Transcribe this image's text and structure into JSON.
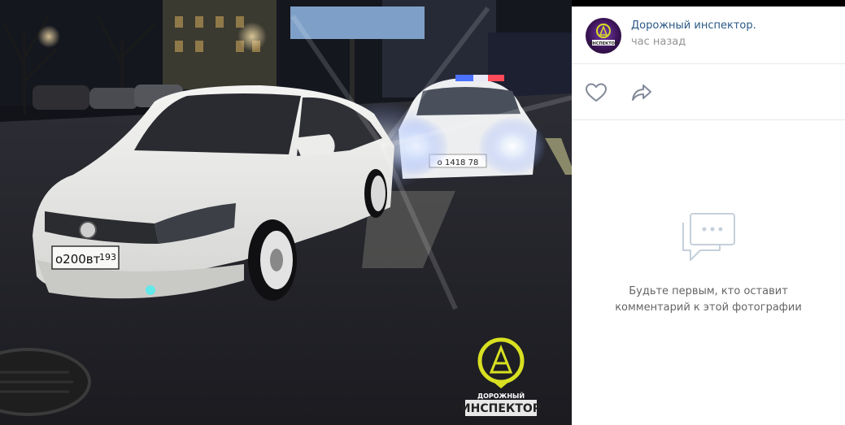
{
  "post": {
    "author": "Дорожный инспектор.",
    "time": "час назад",
    "avatar_text": "ИНСПЕКТОР"
  },
  "photo": {
    "plate_car": "о200вт",
    "plate_region": "193",
    "plate_police": "о 1418 78",
    "watermark_top": "ДОРОЖНЫЙ",
    "watermark_bottom": "ИНСПЕКТОР"
  },
  "actions": {
    "like_icon": "heart-icon",
    "share_icon": "share-arrow-icon"
  },
  "comments": {
    "empty_line1": "Будьте первым, кто оставит",
    "empty_line2": "комментарий к этой фотографии",
    "icon": "comment-bubble-icon"
  },
  "colors": {
    "link": "#2a5885",
    "muted": "#939393",
    "watermark": "#d8e021"
  }
}
